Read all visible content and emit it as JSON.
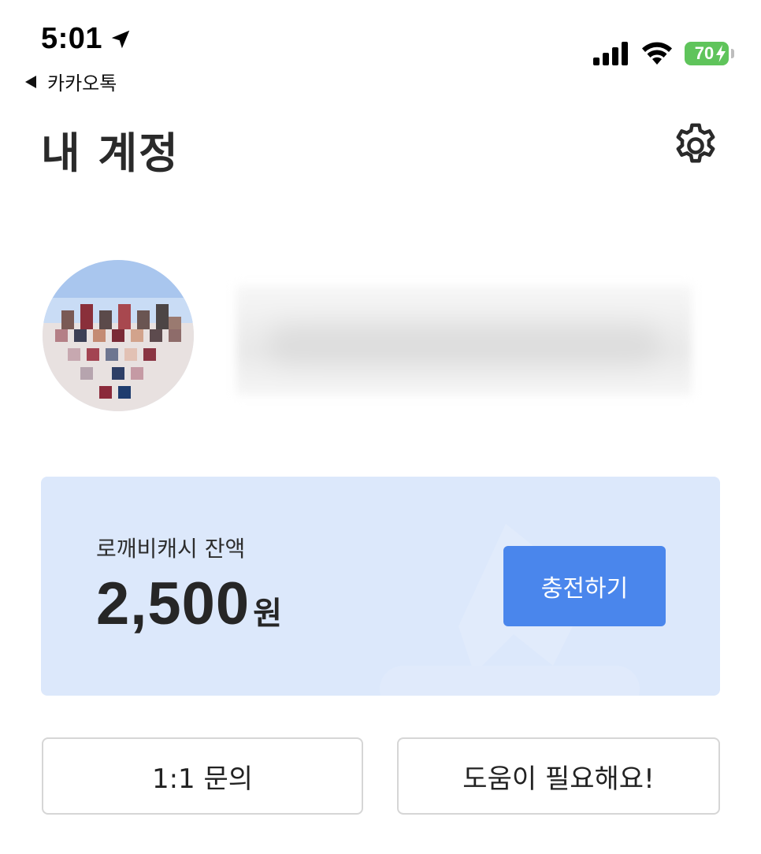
{
  "status_bar": {
    "time": "5:01",
    "back_app": "카카오톡",
    "battery": "70",
    "battery_color": "#5fc45b"
  },
  "header": {
    "title": "내 계정",
    "settings_icon": "gear-icon"
  },
  "profile": {
    "avatar_icon": "avatar"
  },
  "cash": {
    "label": "로깨비캐시 잔액",
    "amount": "2,500",
    "unit": "원",
    "charge_label": "충전하기",
    "card_color": "#dce8fb",
    "button_color": "#4a86ec"
  },
  "actions": {
    "inquiry_label": "1:1 문의",
    "help_label": "도움이 필요해요!"
  }
}
